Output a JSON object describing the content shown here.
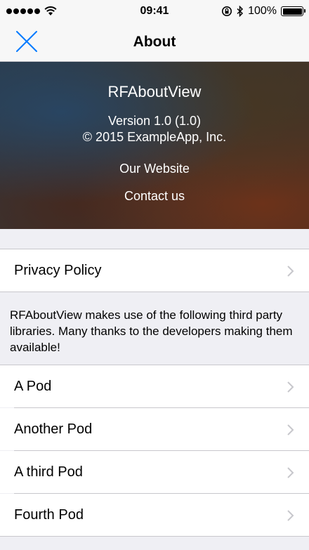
{
  "status_bar": {
    "time": "09:41",
    "battery_label": "100%",
    "icons": [
      "signal-icon",
      "wifi-icon",
      "rotation-lock-icon",
      "bluetooth-icon",
      "battery-icon"
    ]
  },
  "nav": {
    "title": "About",
    "close_icon": "close-icon",
    "accent_color": "#007aff"
  },
  "hero": {
    "app_name": "RFAboutView",
    "version": "Version 1.0 (1.0)",
    "copyright": "© 2015 ExampleApp, Inc.",
    "website_link": "Our Website",
    "contact_link": "Contact us"
  },
  "privacy": {
    "label": "Privacy Policy"
  },
  "acknowledgements": {
    "notice": "RFAboutView makes use of the following third party libraries. Many thanks to the developers making them available!",
    "pods": [
      {
        "label": "A Pod"
      },
      {
        "label": "Another Pod"
      },
      {
        "label": "A third Pod"
      },
      {
        "label": "Fourth Pod"
      }
    ]
  }
}
